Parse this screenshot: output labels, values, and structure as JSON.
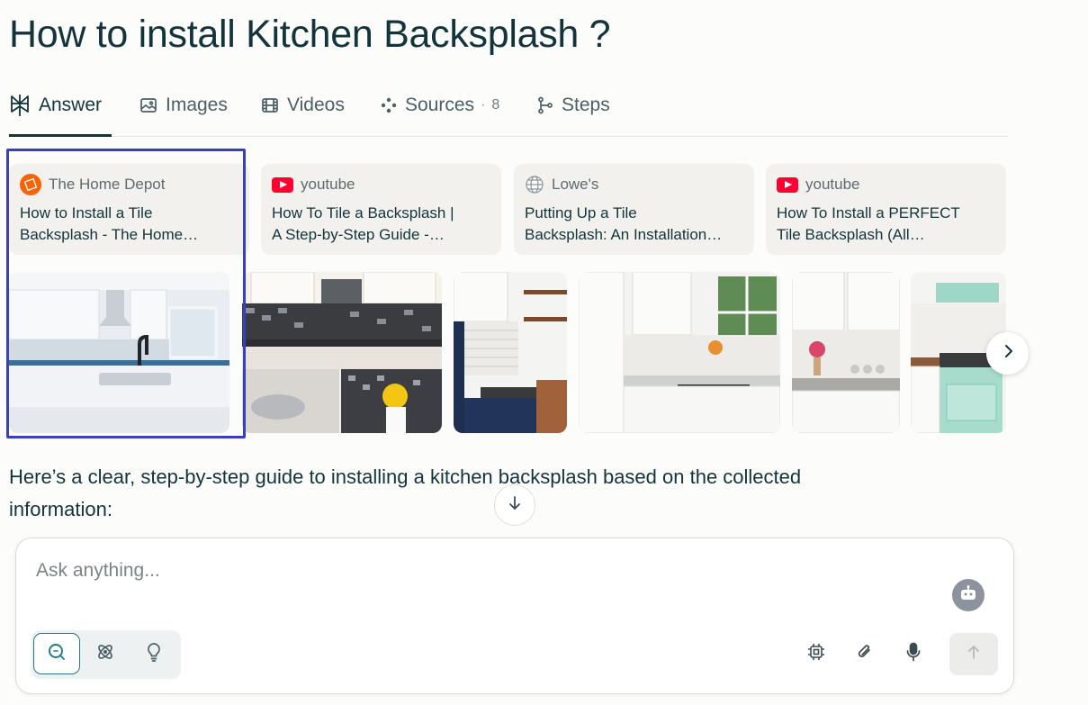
{
  "page": {
    "title": "How to install Kitchen Backsplash ?"
  },
  "tabs": [
    {
      "label": "Answer",
      "icon": "answer-icon"
    },
    {
      "label": "Images",
      "icon": "image-icon"
    },
    {
      "label": "Videos",
      "icon": "video-icon"
    },
    {
      "label": "Sources",
      "icon": "sources-icon",
      "separator": "·",
      "count": "8"
    },
    {
      "label": "Steps",
      "icon": "steps-icon"
    }
  ],
  "sources": [
    {
      "site": "The Home Depot",
      "icon": "home-depot-logo",
      "title_line1": "How to Install a Tile",
      "title_line2": "Backsplash - The Home…"
    },
    {
      "site": "youtube",
      "icon": "youtube-icon",
      "title_line1": "How To Tile a Backsplash |",
      "title_line2": "A Step-by-Step Guide -…"
    },
    {
      "site": "Lowe's",
      "icon": "globe-icon",
      "title_line1": "Putting Up a Tile",
      "title_line2": "Backsplash: An Installation…"
    },
    {
      "site": "youtube",
      "icon": "youtube-icon",
      "title_line1": "How To Install a PERFECT",
      "title_line2": "Tile Backsplash (All…"
    }
  ],
  "answer": {
    "intro": "Here’s a clear, step-by-step guide to installing a kitchen backsplash based on the collected information:"
  },
  "ask": {
    "placeholder": "Ask anything..."
  },
  "colors": {
    "accent": "#1f7a85",
    "highlight": "#3a3fbf",
    "text": "#13343b",
    "youtube": "#ff0033",
    "homedepot": "#f96302"
  }
}
